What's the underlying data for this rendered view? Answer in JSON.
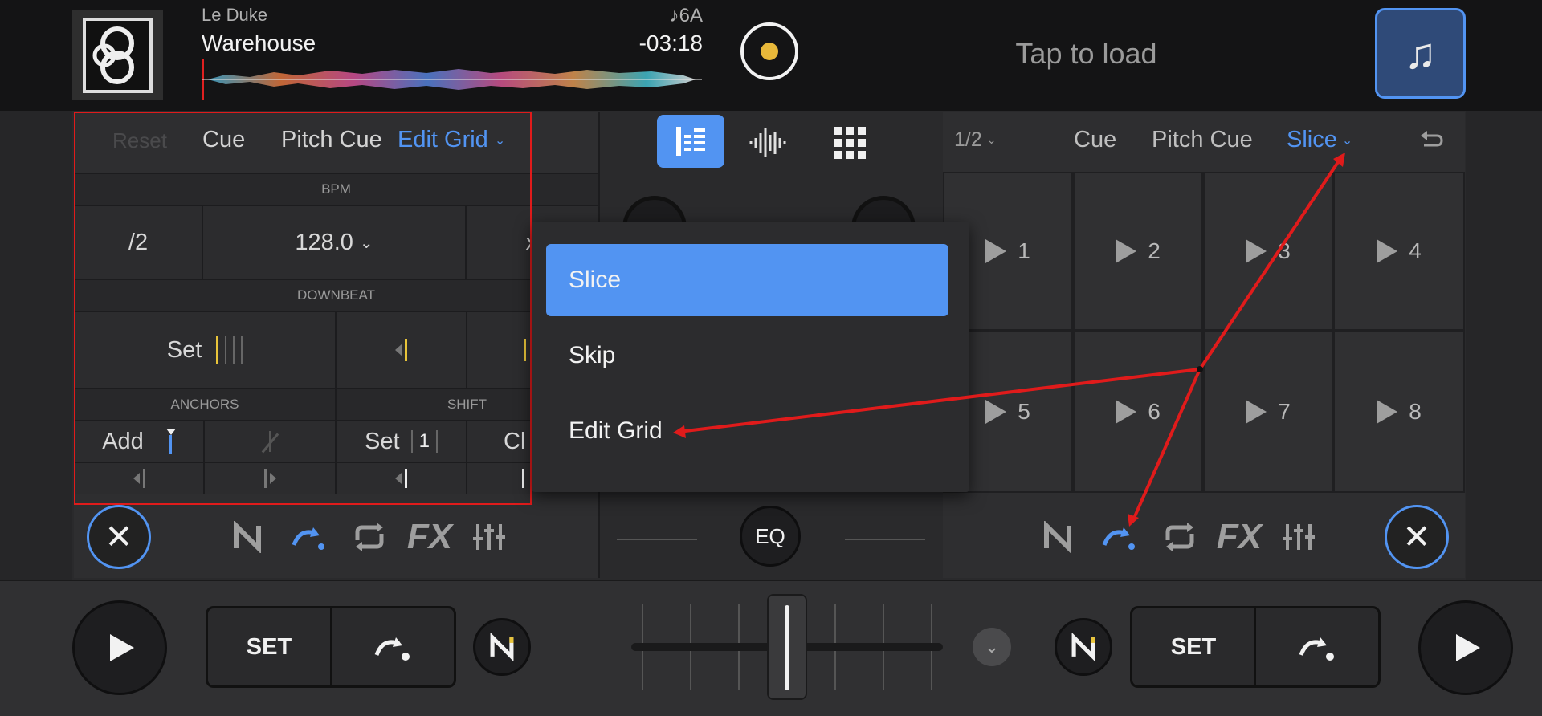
{
  "deckA": {
    "artist": "Le Duke",
    "title": "Warehouse",
    "key": "♪6A",
    "time": "-03:18"
  },
  "deckB": {
    "tap_to_load": "Tap to load"
  },
  "left_toolbar": {
    "reset": "Reset",
    "cue": "Cue",
    "pitch_cue": "Pitch Cue",
    "mode": "Edit Grid"
  },
  "grid_editor": {
    "bpm_label": "BPM",
    "half": "/2",
    "bpm_value": "128.0",
    "double_partial": "x",
    "downbeat_label": "DOWNBEAT",
    "set": "Set",
    "anchors_label": "ANCHORS",
    "shift_label": "SHIFT",
    "add": "Add",
    "shift_set": "Set",
    "shift_value": "1",
    "clear_partial": "Cl"
  },
  "right_toolbar": {
    "loop_size": "1/2",
    "cue": "Cue",
    "pitch_cue": "Pitch Cue",
    "mode": "Slice"
  },
  "pads": [
    "1",
    "2",
    "3",
    "4",
    "5",
    "6",
    "7",
    "8"
  ],
  "dropdown": {
    "items": [
      "Slice",
      "Skip",
      "Edit Grid"
    ],
    "selected": "Slice"
  },
  "center": {
    "eq": "EQ"
  },
  "bottom": {
    "set_left": "SET",
    "set_right": "SET"
  },
  "colors": {
    "accent": "#5294f2",
    "annotation": "#e01b1b",
    "yellow": "#e8c43a"
  }
}
